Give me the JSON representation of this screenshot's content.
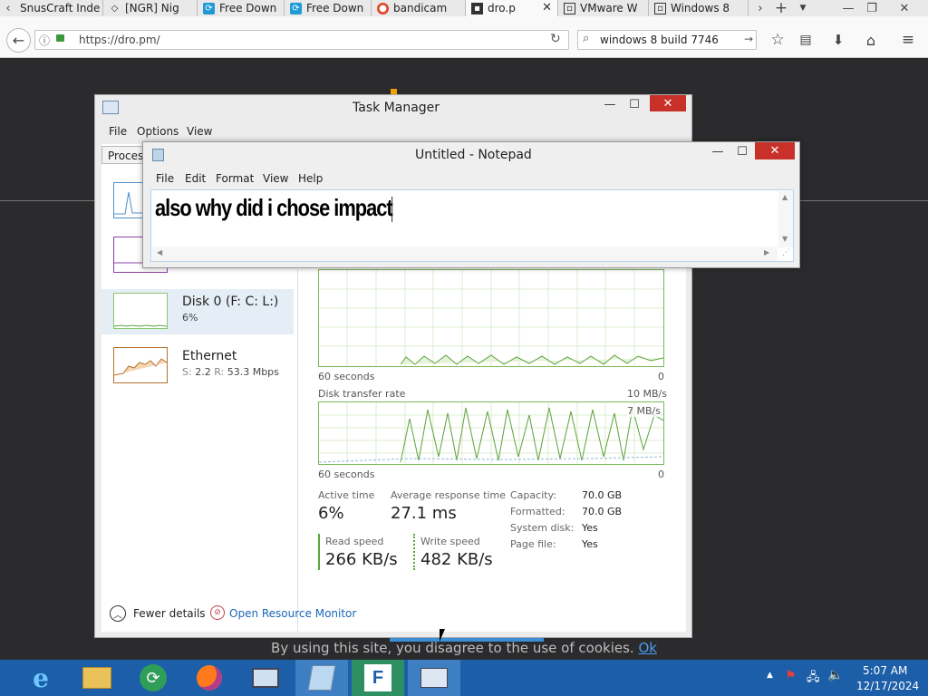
{
  "browser": {
    "tabs": [
      {
        "label": "SnusCraft Inde",
        "icon": "page-icon"
      },
      {
        "label": "[NGR] Nig",
        "icon": "diamond-icon"
      },
      {
        "label": "Free Down",
        "icon": "refresh-icon"
      },
      {
        "label": "Free Down",
        "icon": "refresh-icon"
      },
      {
        "label": "bandicam",
        "icon": "bandicam-icon"
      },
      {
        "label": "dro.p",
        "icon": "page-icon",
        "active": true
      },
      {
        "label": "VMware W",
        "icon": "window-icon"
      },
      {
        "label": "Windows 8",
        "icon": "window-icon"
      }
    ],
    "url": "https://dro.pm/",
    "search_value": "windows 8 build 7746"
  },
  "page": {
    "cookie_text": "By using this site, you disagree to the use of cookies.",
    "cookie_link": "Ok"
  },
  "task_manager": {
    "title": "Task Manager",
    "menu": [
      "File",
      "Options",
      "View"
    ],
    "tab_label": "Proces",
    "disk": {
      "name": "Disk 0 (F: C: L:)",
      "value": "6%"
    },
    "ethernet": {
      "name": "Ethernet",
      "s_label": "S:",
      "s_value": "2.2",
      "r_label": "R:",
      "r_value": "53.3 Mbps"
    },
    "graph1_left": "60 seconds",
    "graph1_right": "0",
    "rate_title": "Disk transfer rate",
    "rate_max": "10 MB/s",
    "rate_mid": "7 MB/s",
    "graph2_left": "60 seconds",
    "graph2_right": "0",
    "active_time_label": "Active time",
    "active_time_value": "6%",
    "avg_resp_label": "Average response time",
    "avg_resp_value": "27.1 ms",
    "read_label": "Read speed",
    "read_value": "266 KB/s",
    "write_label": "Write speed",
    "write_value": "482 KB/s",
    "props": [
      {
        "k": "Capacity:",
        "v": "70.0 GB"
      },
      {
        "k": "Formatted:",
        "v": "70.0 GB"
      },
      {
        "k": "System disk:",
        "v": "Yes"
      },
      {
        "k": "Page file:",
        "v": "Yes"
      }
    ],
    "fewer_details": "Fewer details",
    "resource_monitor": "Open Resource Monitor"
  },
  "notepad": {
    "title": "Untitled - Notepad",
    "menu": [
      "File",
      "Edit",
      "Format",
      "View",
      "Help"
    ],
    "text": "also why did i chose impact"
  },
  "taskbar": {
    "time": "5:07 AM",
    "date": "12/17/2024",
    "colors": {
      "bar": "#1c5fa8",
      "active": "#3e7ec2"
    }
  }
}
